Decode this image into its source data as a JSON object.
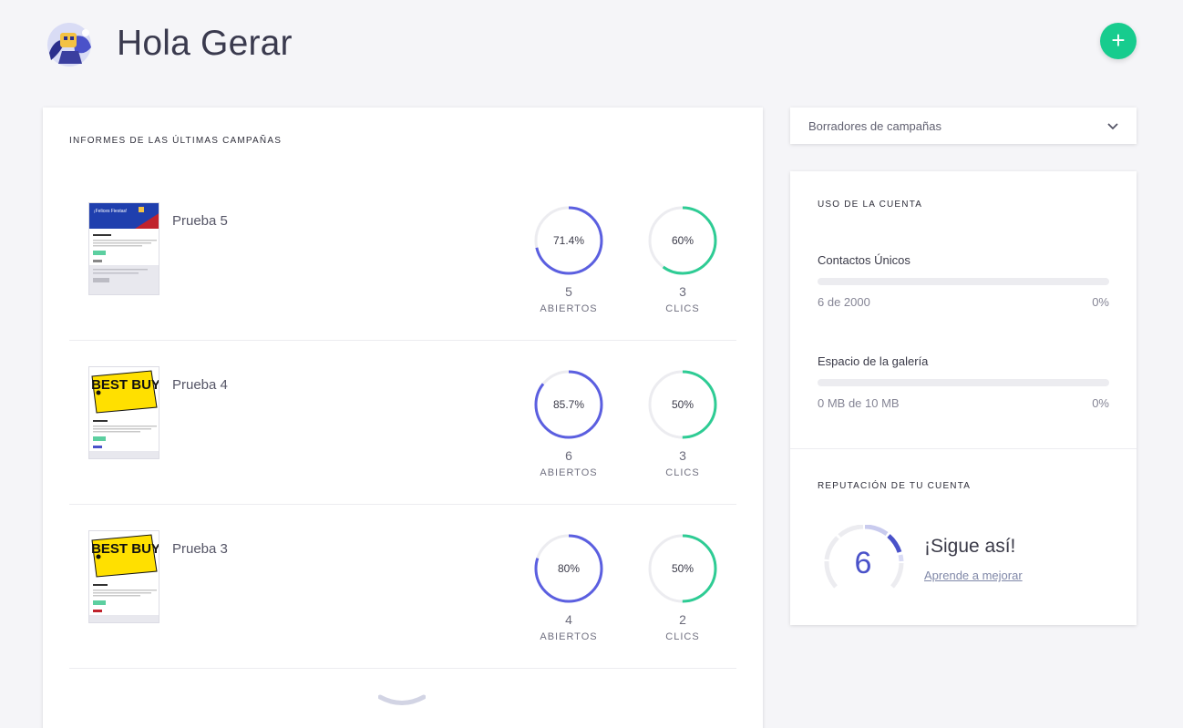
{
  "header": {
    "greeting": "Hola Gerar",
    "add_button": "+"
  },
  "reports": {
    "title": "INFORMES DE LAS ÚLTIMAS CAMPAÑAS",
    "campaigns": [
      {
        "name": "Prueba 5",
        "thumbnail": "felices-fiestas-newsletter",
        "thumb_banner": "¡Felices Fiestas!",
        "opens": {
          "percent": "71.4%",
          "ratio": 0.714,
          "count": "5",
          "label": "ABIERTOS"
        },
        "clicks": {
          "percent": "60%",
          "ratio": 0.6,
          "count": "3",
          "label": "CLICS"
        }
      },
      {
        "name": "Prueba 4",
        "thumbnail": "best-buy-newsletter",
        "thumb_logo": "BEST BUY",
        "opens": {
          "percent": "85.7%",
          "ratio": 0.857,
          "count": "6",
          "label": "ABIERTOS"
        },
        "clicks": {
          "percent": "50%",
          "ratio": 0.5,
          "count": "3",
          "label": "CLICS"
        }
      },
      {
        "name": "Prueba 3",
        "thumbnail": "best-buy-newsletter",
        "thumb_logo": "BEST BUY",
        "opens": {
          "percent": "80%",
          "ratio": 0.8,
          "count": "4",
          "label": "ABIERTOS"
        },
        "clicks": {
          "percent": "50%",
          "ratio": 0.5,
          "count": "2",
          "label": "CLICS"
        }
      }
    ]
  },
  "drafts": {
    "label": "Borradores de campañas",
    "icon": "chevron-down-icon"
  },
  "usage": {
    "title": "USO DE LA CUENTA",
    "contacts": {
      "name": "Contactos Únicos",
      "amount": "6 de 2000",
      "percent": "0%",
      "ratio": 0.0
    },
    "gallery": {
      "name": "Espacio de la galería",
      "amount": "0 MB de 10 MB",
      "percent": "0%",
      "ratio": 0.0
    }
  },
  "reputation": {
    "title": "REPUTACIÓN DE TU CUENTA",
    "score": "6",
    "message": "¡Sigue así!",
    "link": "Aprende a mejorar"
  },
  "colors": {
    "accent": "#5b5fe0",
    "green": "#2ecc94",
    "fab": "#17cc8e",
    "ring_track": "#ececf0"
  }
}
